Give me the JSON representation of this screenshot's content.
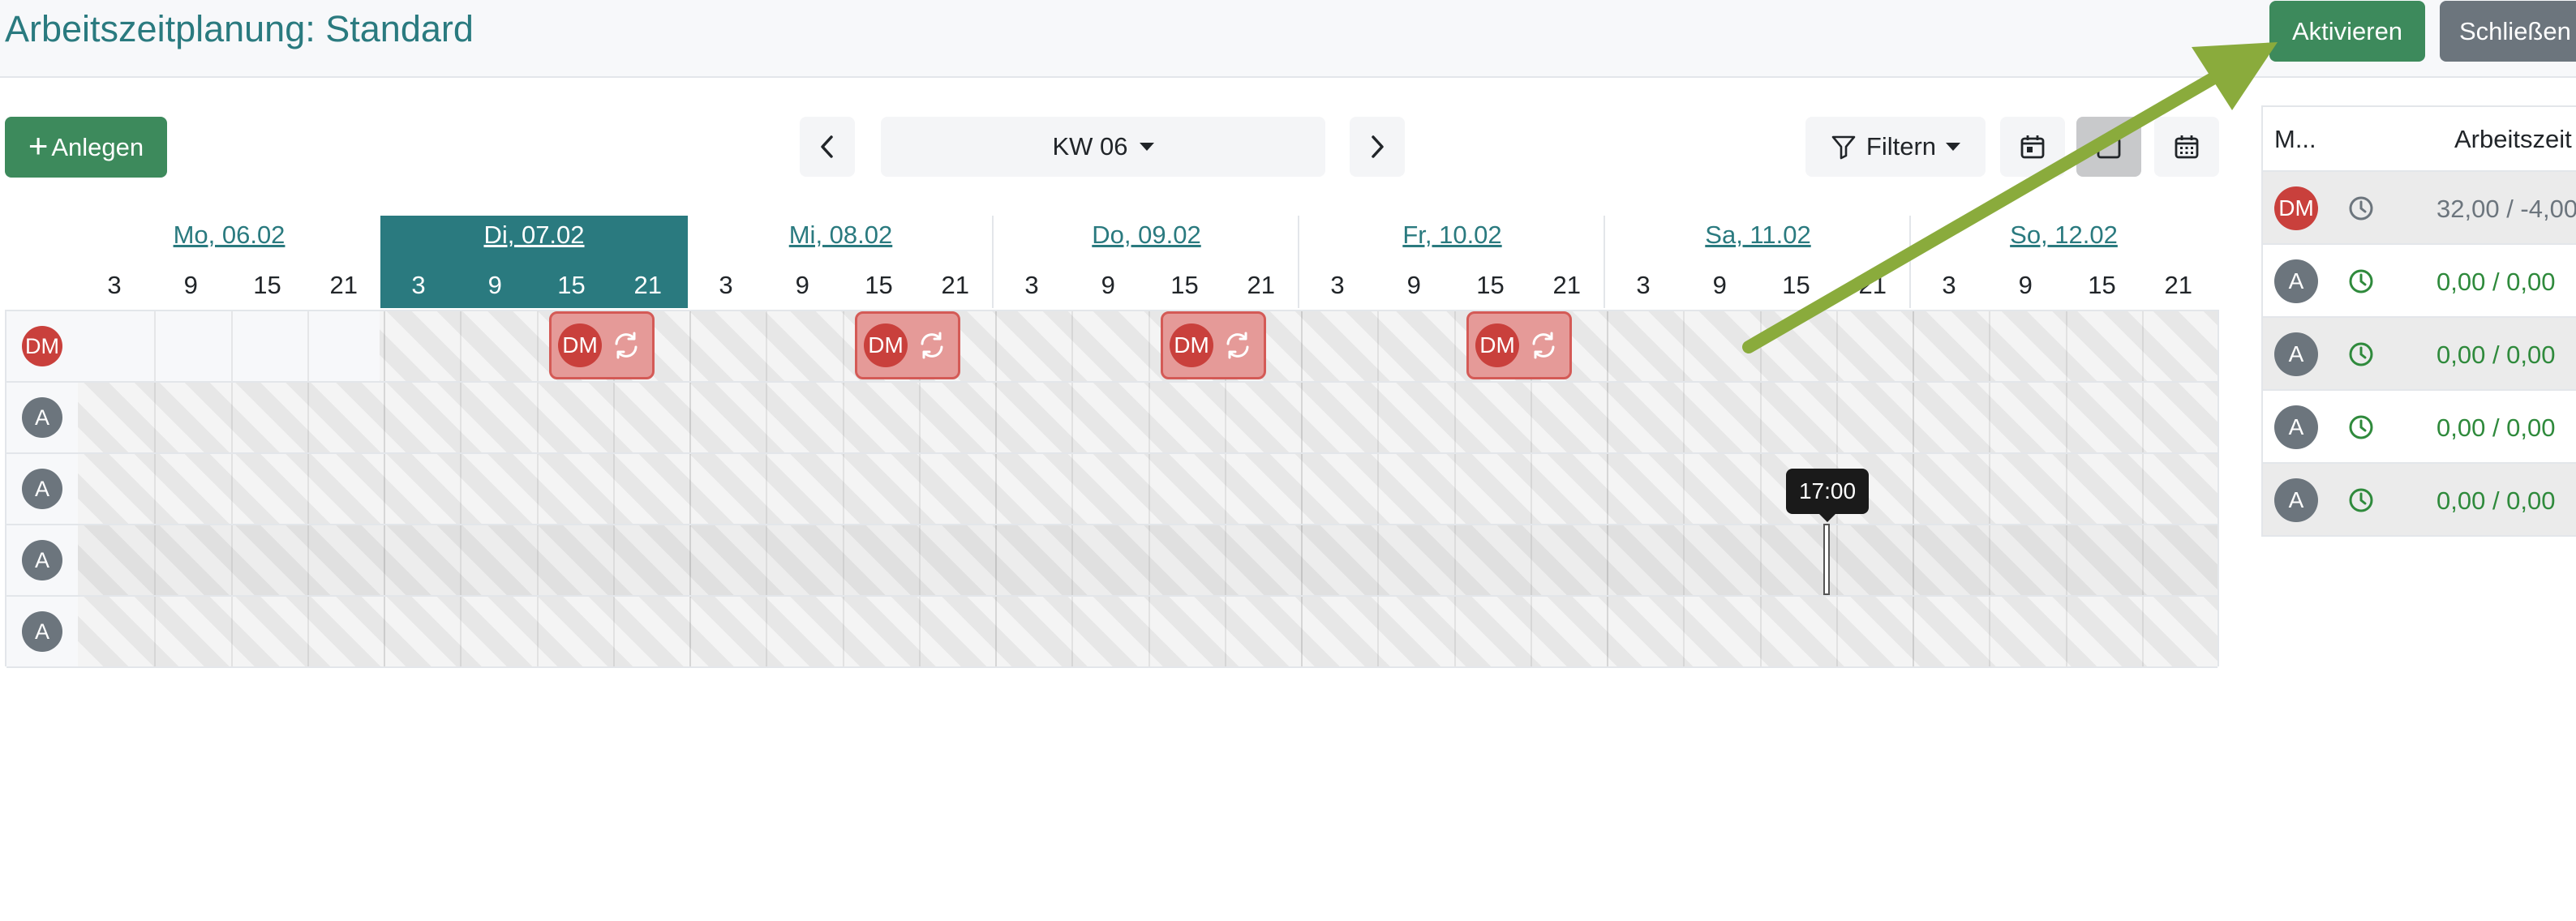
{
  "header": {
    "title": "Arbeitszeitplanung: Standard",
    "activate_label": "Aktivieren",
    "close_label": "Schließen"
  },
  "toolbar": {
    "add_label": "Anlegen",
    "week_label": "KW 06",
    "filter_label": "Filtern"
  },
  "days": [
    {
      "label": "Mo, 06.02",
      "today": false
    },
    {
      "label": "Di, 07.02",
      "today": true
    },
    {
      "label": "Mi, 08.02",
      "today": false
    },
    {
      "label": "Do, 09.02",
      "today": false
    },
    {
      "label": "Fr, 10.02",
      "today": false
    },
    {
      "label": "Sa, 11.02",
      "today": false
    },
    {
      "label": "So, 12.02",
      "today": false
    }
  ],
  "hours": [
    "3",
    "9",
    "15",
    "21"
  ],
  "rows": [
    {
      "initials": "DM",
      "type": "dm"
    },
    {
      "initials": "A",
      "type": "a"
    },
    {
      "initials": "A",
      "type": "a"
    },
    {
      "initials": "A",
      "type": "a"
    },
    {
      "initials": "A",
      "type": "a"
    }
  ],
  "shift_initials": "DM",
  "tooltip": "17:00",
  "side": {
    "col1": "M...",
    "col2": "Arbeitszeit",
    "rows": [
      {
        "initials": "DM",
        "type": "dm",
        "hours": "32,00 / -4,00",
        "color": "grey"
      },
      {
        "initials": "A",
        "type": "a",
        "hours": "0,00 / 0,00",
        "color": "green"
      },
      {
        "initials": "A",
        "type": "a",
        "hours": "0,00 / 0,00",
        "color": "green"
      },
      {
        "initials": "A",
        "type": "a",
        "hours": "0,00 / 0,00",
        "color": "green"
      },
      {
        "initials": "A",
        "type": "a",
        "hours": "0,00 / 0,00",
        "color": "green"
      }
    ]
  },
  "colors": {
    "accent": "#2a7a7f",
    "success": "#3d8a5c",
    "danger": "#c9403c",
    "annotation_arrow": "#8aab3c"
  }
}
